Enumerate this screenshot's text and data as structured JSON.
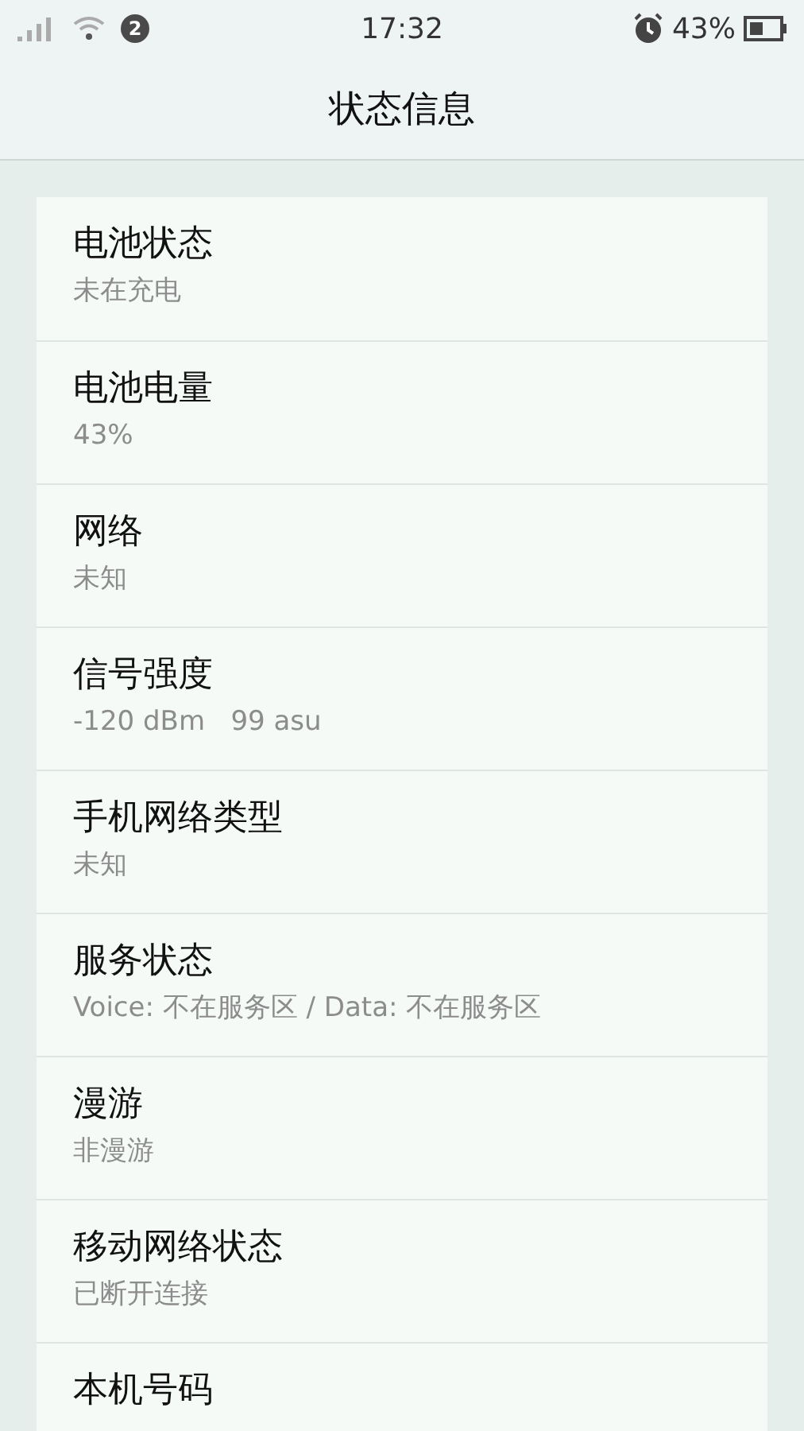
{
  "status_bar": {
    "notification_count": "2",
    "time": "17:32",
    "battery": "43%"
  },
  "header": {
    "title": "状态信息"
  },
  "items": [
    {
      "title": "电池状态",
      "value": "未在充电"
    },
    {
      "title": "电池电量",
      "value": "43%"
    },
    {
      "title": "网络",
      "value": "未知"
    },
    {
      "title": "信号强度",
      "value": "-120 dBm   99 asu"
    },
    {
      "title": "手机网络类型",
      "value": "未知"
    },
    {
      "title": "服务状态",
      "value": "Voice: 不在服务区 / Data: 不在服务区"
    },
    {
      "title": "漫游",
      "value": "非漫游"
    },
    {
      "title": "移动网络状态",
      "value": "已断开连接"
    },
    {
      "title": "本机号码"
    }
  ]
}
